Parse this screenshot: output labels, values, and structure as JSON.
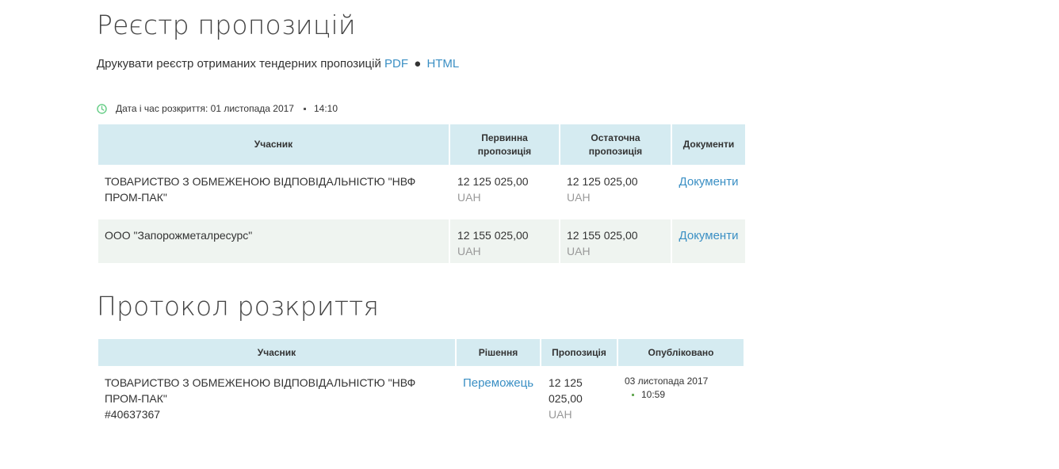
{
  "registry": {
    "title": "Реєстр пропозицій",
    "print_text": "Друкувати реєстр отриманих тендерних пропозицій",
    "print_pdf": "PDF",
    "print_bullet": "●",
    "print_html": "HTML",
    "open_label": "Дата і час розкриття: 01 листопада 2017",
    "open_time": "14:10",
    "columns": [
      "Учасник",
      "Первинна пропозиція",
      "Остаточна пропозиція",
      "Документи"
    ],
    "rows": [
      {
        "participant": "ТОВАРИСТВО З ОБМЕЖЕНОЮ ВІДПОВІДАЛЬНІСТЮ \"НВФ ПРОМ-ПАК\"",
        "initial_amount": "12 125 025,00",
        "initial_currency": "UAH",
        "final_amount": "12 125 025,00",
        "final_currency": "UAH",
        "documents": "Документи"
      },
      {
        "participant": "ООО \"Запорожметалресурс\"",
        "initial_amount": "12 155 025,00",
        "initial_currency": "UAH",
        "final_amount": "12 155 025,00",
        "final_currency": "UAH",
        "documents": "Документи"
      }
    ]
  },
  "protocol": {
    "title": "Протокол розкриття",
    "columns": [
      "Учасник",
      "Рішення",
      "Пропозиція",
      "Опубліковано"
    ],
    "rows": [
      {
        "participant": "ТОВАРИСТВО З ОБМЕЖЕНОЮ ВІДПОВІДАЛЬНІСТЮ \"НВФ ПРОМ-ПАК\"",
        "participant_id": "#40637367",
        "decision": "Переможець",
        "amount": "12 125 025,00",
        "currency": "UAH",
        "published_date": "03 листопада 2017",
        "published_time": "10:59"
      }
    ]
  },
  "colors": {
    "link": "#3a8fc4",
    "header_bg": "#d5ebf1",
    "alt_row_bg": "#eff4f0",
    "clock": "#6bcf8a"
  }
}
